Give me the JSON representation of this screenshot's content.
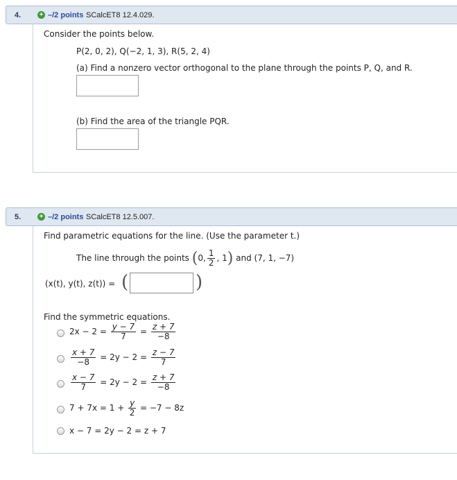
{
  "q4": {
    "number": "4.",
    "points": "–/2 points",
    "source": "SCalcET8 12.4.029.",
    "prompt": "Consider the points below.",
    "points_list": "P(2, 0, 2),  Q(−2, 1, 3),  R(5, 2, 4)",
    "part_a": "(a) Find a nonzero vector orthogonal to the plane through the points  P, Q,  and R.",
    "part_b": "(b) Find the area of the triangle PQR."
  },
  "q5": {
    "number": "5.",
    "points": "–/2 points",
    "source": "SCalcET8 12.5.007.",
    "prompt": "Find parametric equations for the line. (Use the parameter t.)",
    "line_desc_pre": "The line through the points",
    "point1_a": "0,",
    "point1_num": "1",
    "point1_den": "2",
    "point1_c": ", 1",
    "line_desc_and": "and (7, 1, −7)",
    "param_label": "(x(t), y(t), z(t))  =",
    "symmetric_prompt": "Find the symmetric equations.",
    "options": [
      {
        "pre": "2x − 2 = ",
        "f1n": "y − 7",
        "f1d": "7",
        "mid": " = ",
        "f2n": "z + 7",
        "f2d": "−8"
      },
      {
        "f0n": "x + 7",
        "f0d": "−8",
        "mid1": " = 2y − 2 = ",
        "f2n": "z − 7",
        "f2d": "7"
      },
      {
        "f0n": "x − 7",
        "f0d": "7",
        "mid1": " = 2y − 2 = ",
        "f2n": "z + 7",
        "f2d": "−8"
      },
      {
        "pre": "7 + 7x = 1 + ",
        "f1n": "y",
        "f1d": "2",
        "post": " = −7 − 8z"
      },
      {
        "text": "x − 7 = 2y − 2 = z + 7"
      }
    ]
  }
}
